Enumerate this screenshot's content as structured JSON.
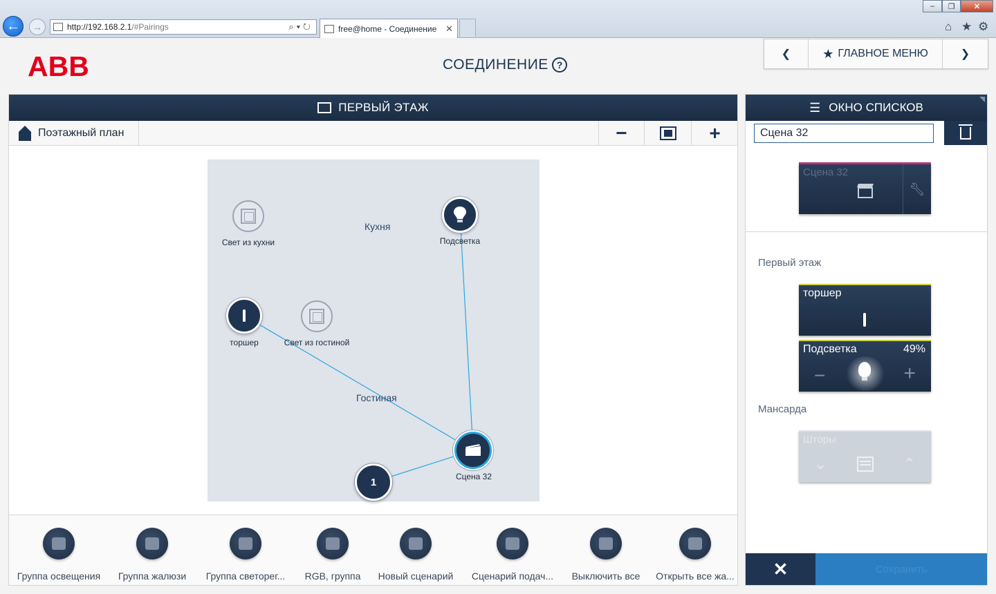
{
  "browser": {
    "url_host": "http://192.168.2.1",
    "url_path": "/#Pairings",
    "tab_title": "free@home - Соединение"
  },
  "header": {
    "logo": "ABB",
    "title": "СОЕДИНЕНИЕ",
    "help": "?",
    "nav_main": "ГЛАВНОЕ МЕНЮ"
  },
  "left_panel": {
    "title": "ПЕРВЫЙ ЭТАЖ",
    "floorplan_label": "Поэтажный план",
    "rooms": [
      "Кухня",
      "Гостиная"
    ],
    "devices": {
      "kitchen_light": "Свет из кухни",
      "backlight": "Подсветка",
      "torsher": "торшер",
      "living_light": "Свет из гостиной",
      "scene": "Сцена 32",
      "sensor_number": "1"
    },
    "tools": [
      "Группа освещения",
      "Группа жалюзи",
      "Группа светорег...",
      "RGB, группа",
      "Новый сценарий",
      "Сценарий подач...",
      "Выключить все",
      "Открыть все жа..."
    ]
  },
  "right_panel": {
    "title": "ОКНО СПИСКОВ",
    "scene_input_value": "Сцена 32",
    "scene_tile_title": "Сцена 32",
    "section_first_floor": "Первый этаж",
    "torsher_tile": "торшер",
    "dimmer_tile": "Подсветка",
    "dimmer_value": "49%",
    "section_attic": "Мансарда",
    "blinds_tile": "Шторы",
    "cancel_symbol": "✕",
    "save_label": "Сохранить"
  },
  "colors": {
    "header_dark": "#1b2d44",
    "accent_blue": "#2aa8e0",
    "logo_red": "#e2001a",
    "tile_yellow": "#c7d23c",
    "tile_magenta": "#b6337a"
  }
}
